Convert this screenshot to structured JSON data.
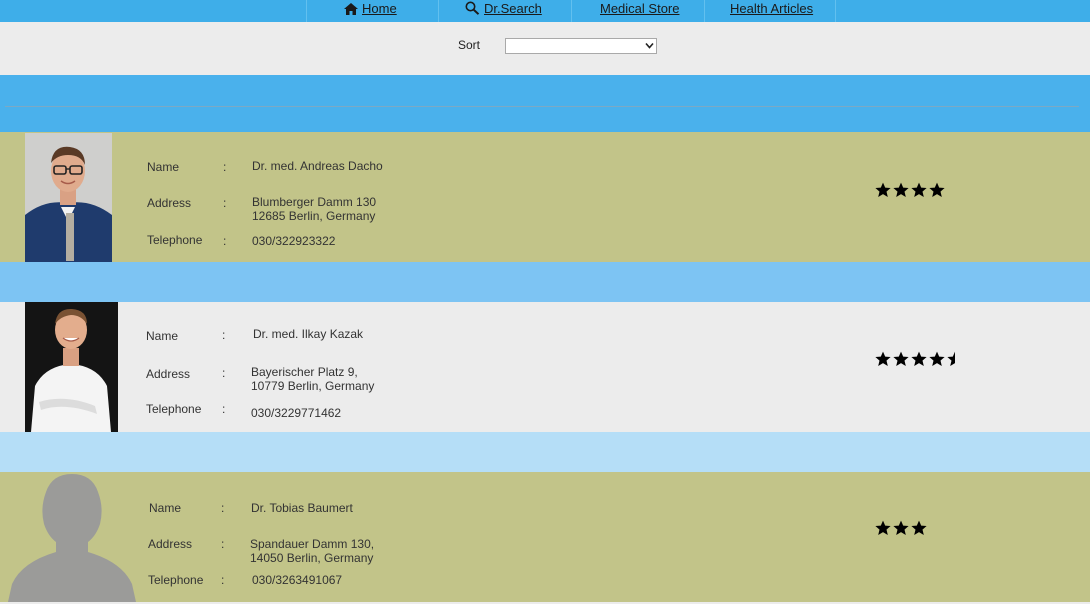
{
  "nav": {
    "home": "Home",
    "drsearch": "Dr.Search",
    "store": "Medical Store",
    "articles": "Health Articles"
  },
  "sort": {
    "label": "Sort",
    "selected": ""
  },
  "field_labels": {
    "name": "Name",
    "address": "Address",
    "telephone": "Telephone",
    "colon": ":"
  },
  "doctors": [
    {
      "name": "Dr. med. Andreas Dacho",
      "address_line1": "Blumberger Damm 130",
      "address_line2": "12685 Berlin, Germany",
      "telephone": "030/322923322",
      "rating": 4
    },
    {
      "name": "Dr. med. Ilkay Kazak",
      "address_line1": "Bayerischer Platz 9,",
      "address_line2": "10779 Berlin, Germany",
      "telephone": "030/3229771462",
      "rating": 4.5
    },
    {
      "name": "Dr. Tobias Baumert",
      "address_line1": "Spandauer Damm 130,",
      "address_line2": "14050 Berlin, Germany",
      "telephone": "030/3263491067",
      "rating": 3
    }
  ],
  "colors": {
    "nav_bg": "#3eaee9",
    "band_blue": "#4ab1ec",
    "row_olive": "#c2c489",
    "row_grey": "#ececec",
    "star": "#000000"
  }
}
